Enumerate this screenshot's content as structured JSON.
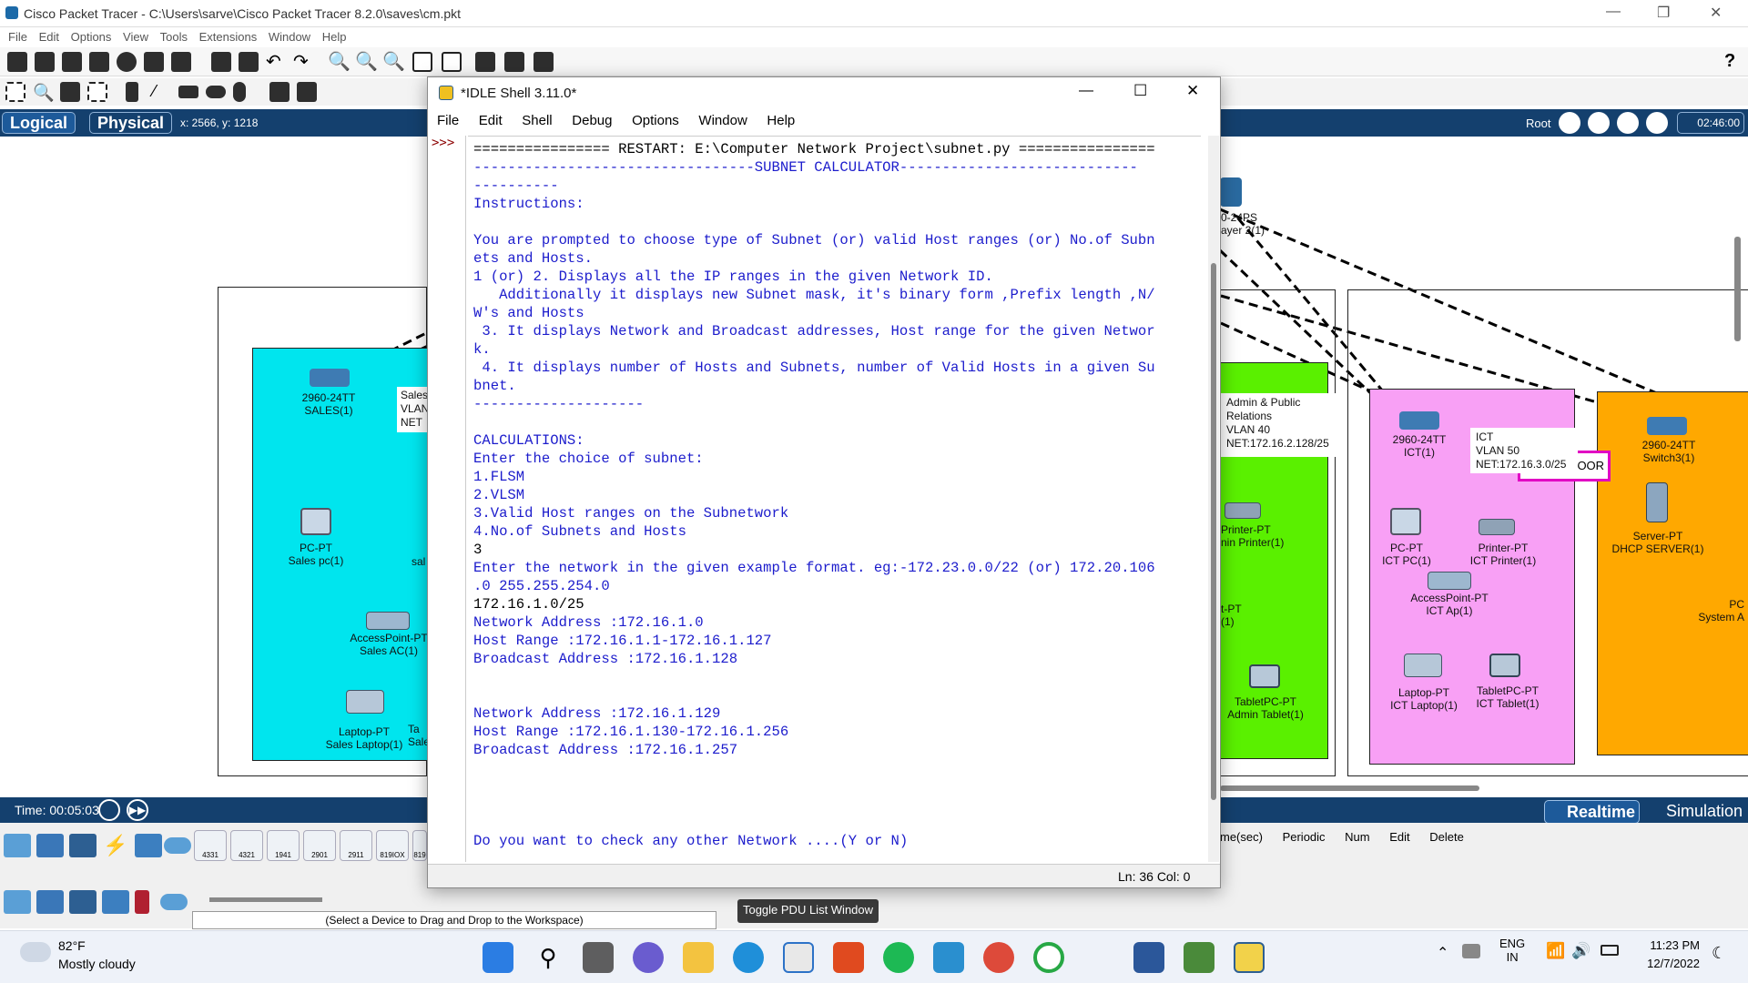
{
  "pt": {
    "title": "Cisco Packet Tracer - C:\\Users\\sarve\\Cisco Packet Tracer 8.2.0\\saves\\cm.pkt",
    "menu": [
      "File",
      "Edit",
      "Options",
      "View",
      "Tools",
      "Extensions",
      "Window",
      "Help"
    ],
    "tab_logical": "Logical",
    "tab_physical": "Physical",
    "coords": "x: 2566, y: 1218",
    "root": "Root",
    "clock": "02:46:00",
    "time": "Time: 00:05:03",
    "realtime": "Realtime",
    "simulation": "Simulation",
    "hint": "(Select a Device to Drag and Drop to the Workspace)",
    "pdu_button": "Toggle PDU List Window",
    "sim_headers": [
      "me(sec)",
      "Periodic",
      "Num",
      "Edit",
      "Delete"
    ],
    "device_models": [
      "4331",
      "4321",
      "1941",
      "2901",
      "2911",
      "819IOX",
      "819"
    ],
    "third_floor": "THIRD FLOOR",
    "devices": {
      "sales_switch": [
        "2960-24TT",
        "SALES(1)"
      ],
      "sales_label": [
        "Sales",
        "VLAN",
        "NET"
      ],
      "sales_pc": [
        "PC-PT",
        "Sales pc(1)"
      ],
      "sales_ap": [
        "AccessPoint-PT",
        "Sales AC(1)"
      ],
      "sales_laptop": [
        "Laptop-PT",
        "Sales Laptop(1)"
      ],
      "sales_partial": [
        "sal"
      ],
      "sales_tablet": [
        "Ta",
        "Sale"
      ],
      "l3_switch": [
        "0-24PS",
        "ayer 2(1)"
      ],
      "admin_label": [
        "Admin & Public",
        "Relations",
        "VLAN 40",
        "NET:172.16.2.128/25"
      ],
      "admin_printer": [
        "Printer-PT",
        "nin Printer(1)"
      ],
      "admin_pc": [
        "t-PT",
        "(1)"
      ],
      "admin_tablet": [
        "TabletPC-PT",
        "Admin Tablet(1)"
      ],
      "ict_switch": [
        "2960-24TT",
        "ICT(1)"
      ],
      "ict_label": [
        "ICT",
        "VLAN 50",
        "NET:172.16.3.0/25"
      ],
      "ict_pc": [
        "PC-PT",
        "ICT PC(1)"
      ],
      "ict_printer": [
        "Printer-PT",
        "ICT Printer(1)"
      ],
      "ict_ap": [
        "AccessPoint-PT",
        "ICT Ap(1)"
      ],
      "ict_laptop": [
        "Laptop-PT",
        "ICT Laptop(1)"
      ],
      "ict_tablet": [
        "TabletPC-PT",
        "ICT Tablet(1)"
      ],
      "third_switch": [
        "2960-24TT",
        "Switch3(1)"
      ],
      "server": [
        "Server-PT",
        "DHCP SERVER(1)"
      ],
      "system_pc": [
        "PC",
        "System A"
      ]
    }
  },
  "idle": {
    "title": "*IDLE Shell 3.11.0*",
    "menu": [
      "File",
      "Edit",
      "Shell",
      "Debug",
      "Options",
      "Window",
      "Help"
    ],
    "prompt": ">>>",
    "restart_line": "================ RESTART: E:\\Computer Network Project\\subnet.py ================",
    "lines": [
      {
        "t": "---------------------------------SUBNET CALCULATOR----------------------------",
        "c": "out"
      },
      {
        "t": "----------",
        "c": "out"
      },
      {
        "t": "Instructions:",
        "c": "out"
      },
      {
        "t": "",
        "c": "out"
      },
      {
        "t": "You are prompted to choose type of Subnet (or) valid Host ranges (or) No.of Subn",
        "c": "out"
      },
      {
        "t": "ets and Hosts.",
        "c": "out"
      },
      {
        "t": "1 (or) 2. Displays all the IP ranges in the given Network ID.",
        "c": "out"
      },
      {
        "t": "   Additionally it displays new Subnet mask, it's binary form ,Prefix length ,N/",
        "c": "out"
      },
      {
        "t": "W's and Hosts",
        "c": "out"
      },
      {
        "t": " 3. It displays Network and Broadcast addresses, Host range for the given Networ",
        "c": "out"
      },
      {
        "t": "k.",
        "c": "out"
      },
      {
        "t": " 4. It displays number of Hosts and Subnets, number of Valid Hosts in a given Su",
        "c": "out"
      },
      {
        "t": "bnet.",
        "c": "out"
      },
      {
        "t": "--------------------",
        "c": "out"
      },
      {
        "t": "",
        "c": "out"
      },
      {
        "t": "CALCULATIONS:",
        "c": "out"
      },
      {
        "t": "Enter the choice of subnet:",
        "c": "out"
      },
      {
        "t": "1.FLSM",
        "c": "out"
      },
      {
        "t": "2.VLSM",
        "c": "out"
      },
      {
        "t": "3.Valid Host ranges on the Subnetwork",
        "c": "out"
      },
      {
        "t": "4.No.of Subnets and Hosts",
        "c": "out"
      },
      {
        "t": "3",
        "c": "inp"
      },
      {
        "t": "Enter the network in the given example format. eg:-172.23.0.0/22 (or) 172.20.106",
        "c": "out"
      },
      {
        "t": ".0 255.255.254.0",
        "c": "out"
      },
      {
        "t": "172.16.1.0/25",
        "c": "inp"
      },
      {
        "t": "Network Address :172.16.1.0",
        "c": "out"
      },
      {
        "t": "Host Range :172.16.1.1-172.16.1.127",
        "c": "out"
      },
      {
        "t": "Broadcast Address :172.16.1.128",
        "c": "out"
      },
      {
        "t": "",
        "c": "out"
      },
      {
        "t": "",
        "c": "out"
      },
      {
        "t": "Network Address :172.16.1.129",
        "c": "out"
      },
      {
        "t": "Host Range :172.16.1.130-172.16.1.256",
        "c": "out"
      },
      {
        "t": "Broadcast Address :172.16.1.257",
        "c": "out"
      },
      {
        "t": "",
        "c": "out"
      },
      {
        "t": "",
        "c": "out"
      },
      {
        "t": "",
        "c": "out"
      },
      {
        "t": "",
        "c": "out"
      },
      {
        "t": "Do you want to check any other Network ....(Y or N)",
        "c": "out"
      }
    ],
    "status": "Ln: 36   Col: 0"
  },
  "taskbar": {
    "temp": "82°F",
    "weather": "Mostly cloudy",
    "lang1": "ENG",
    "lang2": "IN",
    "time": "11:23 PM",
    "date": "12/7/2022"
  }
}
